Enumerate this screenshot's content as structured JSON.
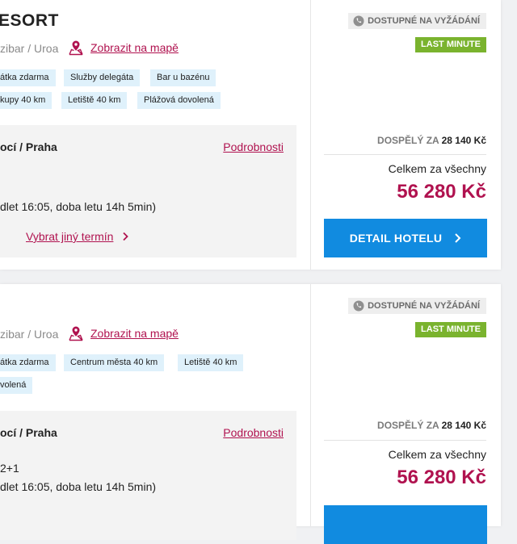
{
  "colors": {
    "accent": "#b0124f",
    "button": "#118be0",
    "last_minute": "#7ab32e",
    "tag_bg": "#dff1fb"
  },
  "results": [
    {
      "hotel_name": "ESORT",
      "location": "zibar / Uroa",
      "map_link": "Zobrazit na mapě",
      "tags_row1": [
        "átka zdarma",
        "Služby delegáta",
        "Bar u bazénu"
      ],
      "tags_row2": [
        "kupy 40 km",
        "Letiště 40 km",
        "Plážová dovolená"
      ],
      "flight_route": "ocí / Praha",
      "flight_details_link": "Podrobnosti",
      "flight_extra": "",
      "flight_time": "dlet 16:05, doba letu 14h 5min)",
      "change_term": "Vybrat jiný termín",
      "availability": "DOSTUPNÉ NA VYŽÁDÁNÍ",
      "badge": "LAST MINUTE",
      "per_adult_label": "DOSPĚLÝ ZA",
      "per_adult_amount": "28 140 Kč",
      "total_label": "Celkem za všechny",
      "total_price": "56 280 Kč",
      "detail_button": "DETAIL HOTELU"
    },
    {
      "location": "zibar / Uroa",
      "map_link": "Zobrazit na mapě",
      "tags_row1": [
        "átka zdarma",
        "Centrum města 40 km",
        "Letiště 40 km"
      ],
      "tags_row2": [
        "volená"
      ],
      "flight_route": "ocí / Praha",
      "flight_details_link": "Podrobnosti",
      "flight_extra": "2+1",
      "flight_time": "dlet 16:05, doba letu 14h 5min)",
      "availability": "DOSTUPNÉ NA VYŽÁDÁNÍ",
      "badge": "LAST MINUTE",
      "per_adult_label": "DOSPĚLÝ ZA",
      "per_adult_amount": "28 140 Kč",
      "total_label": "Celkem za všechny",
      "total_price": "56 280 Kč"
    }
  ]
}
